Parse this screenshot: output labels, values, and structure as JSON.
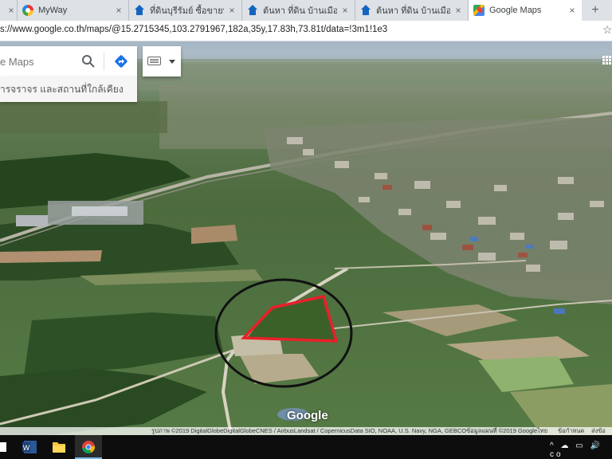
{
  "browser": {
    "tabs": [
      {
        "title": "",
        "icon": "partial-tab-icon",
        "active": false
      },
      {
        "title": "MyWay",
        "icon": "myway-icon",
        "active": false
      },
      {
        "title": "ที่ดินบุรีรัมย์ ซื้อขายที่ดินในบุ",
        "icon": "house-icon",
        "active": false
      },
      {
        "title": "ต้นหา ที่ดิน บ้านเมืองสอง ลง",
        "icon": "house-icon",
        "active": false
      },
      {
        "title": "ต้นหา ที่ดิน บ้านเมืองสอง ลง",
        "icon": "house-icon",
        "active": false
      },
      {
        "title": "Google Maps",
        "icon": "google-maps-icon",
        "active": true
      }
    ],
    "close_glyph": "×",
    "new_tab_glyph": "+",
    "url": "s://www.google.co.th/maps/@15.2715345,103.2791967,182a,35y,17.83h,73.81t/data=!3m1!1e3"
  },
  "maps": {
    "search_placeholder": "e Maps",
    "nearby_text": "ารจราจร และสถานที่ใกล้เคียง",
    "logo": "Google",
    "attribution_left": "รูปภาพ ©2019 DigitalGlobeDigitalGlobeCNES / AirbusLandsat / CopernicusData SIO, NOAA, U.S. Navy, NGA, GEBCOข้อมูลแผนที่ ©2019 Google",
    "attribution_lang": "ไทย",
    "attribution_terms": "ข้อกำหนด",
    "attribution_feedback": "ส่งข้อ"
  },
  "colors": {
    "boundary": "#e8202a",
    "circle": "#111111",
    "taskbar": "#0d0d0d"
  },
  "taskbar": {
    "apps": [
      "partial-app-icon",
      "word-icon",
      "file-explorer-icon",
      "chrome-icon"
    ],
    "tray_text": "^ ☁ ▭ 🔊 co"
  }
}
